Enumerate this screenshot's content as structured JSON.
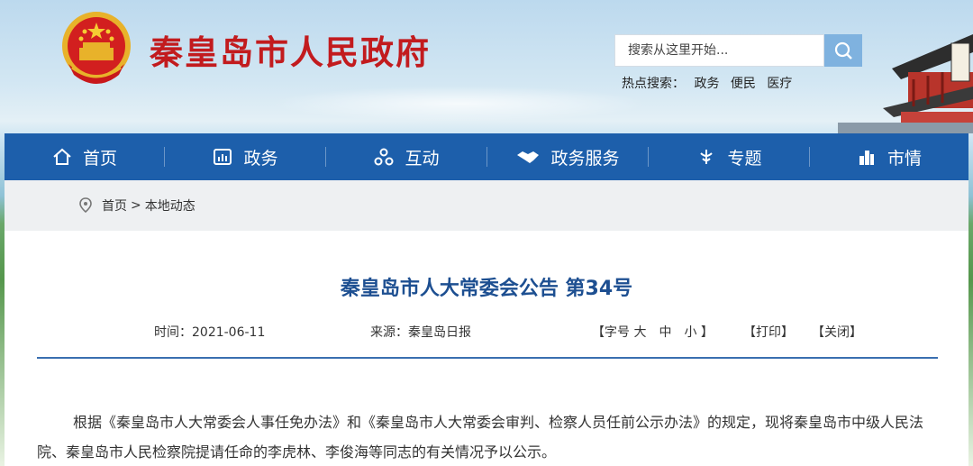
{
  "header": {
    "site_title": "秦皇岛市人民政府",
    "search_placeholder": "搜索从这里开始...",
    "hot_label": "热点搜索：",
    "hot_items": [
      "政务",
      "便民",
      "医疗"
    ]
  },
  "nav": {
    "items": [
      {
        "label": "首页",
        "icon": "home-icon"
      },
      {
        "label": "政务",
        "icon": "chart-icon"
      },
      {
        "label": "互动",
        "icon": "interact-icon"
      },
      {
        "label": "政务服务",
        "icon": "handshake-icon"
      },
      {
        "label": "专题",
        "icon": "topic-icon"
      },
      {
        "label": "市情",
        "icon": "city-icon"
      }
    ]
  },
  "breadcrumb": {
    "home": "首页",
    "separator": ">",
    "current": "本地动态"
  },
  "article": {
    "title": "秦皇岛市人大常委会公告 第34号",
    "time": "时间：2021-06-11",
    "source": "来源：秦皇岛日报",
    "font_size": "【字号 大　中　小 】",
    "print": "【打印】",
    "close": "【关闭】",
    "paragraph": "根据《秦皇岛市人大常委会人事任免办法》和《秦皇岛市人大常委会审判、检察人员任前公示办法》的规定，现将秦皇岛市中级人民法院、秦皇岛市人民检察院提请任命的李虎林、李俊海等同志的有关情况予以公示。"
  },
  "colors": {
    "nav_bg": "#1d5fab",
    "title_red": "#c21b1e",
    "article_title_blue": "#1d4f91"
  }
}
